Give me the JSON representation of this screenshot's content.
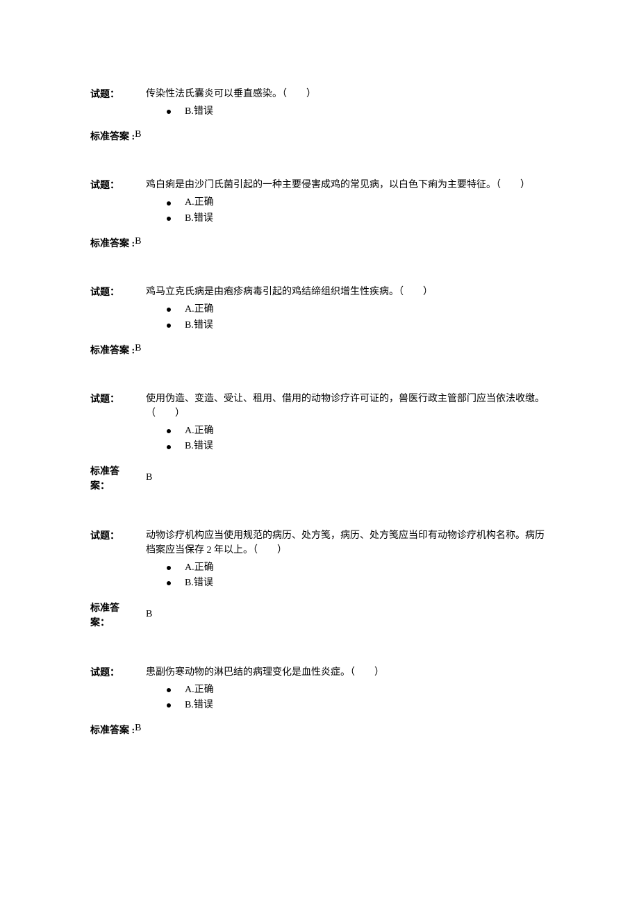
{
  "labels": {
    "question": "试题：",
    "answer": "标准答案 :",
    "answer_wrap": "标准答案："
  },
  "questions": [
    {
      "text": "传染性法氏囊炎可以垂直感染。（　　）",
      "options": [
        {
          "label": "B.错误"
        }
      ],
      "answer": "B",
      "wrap_label": false
    },
    {
      "text": "鸡白痢是由沙门氏菌引起的一种主要侵害成鸡的常见病，以白色下痢为主要特征。（　　）",
      "options": [
        {
          "label": "A.正确"
        },
        {
          "label": "B.错误"
        }
      ],
      "answer": "B",
      "wrap_label": false
    },
    {
      "text": "鸡马立克氏病是由疱疹病毒引起的鸡结缔组织增生性疾病。（　　）",
      "options": [
        {
          "label": "A.正确"
        },
        {
          "label": "B.错误"
        }
      ],
      "answer": "B",
      "wrap_label": false
    },
    {
      "text": "使用伪造、变造、受让、租用、借用的动物诊疗许可证的，兽医行政主管部门应当依法收缴。（　　）",
      "options": [
        {
          "label": "A.正确"
        },
        {
          "label": "B.错误"
        }
      ],
      "answer": "B",
      "wrap_label": true
    },
    {
      "text": "动物诊疗机构应当使用规范的病历、处方笺，病历、处方笺应当印有动物诊疗机构名称。病历档案应当保存 2 年以上。（　　）",
      "options": [
        {
          "label": "A.正确"
        },
        {
          "label": "B.错误"
        }
      ],
      "answer": "B",
      "wrap_label": true
    },
    {
      "text": "患副伤寒动物的淋巴结的病理变化是血性炎症。（　　）",
      "options": [
        {
          "label": "A.正确"
        },
        {
          "label": "B.错误"
        }
      ],
      "answer": "B",
      "wrap_label": false
    }
  ]
}
